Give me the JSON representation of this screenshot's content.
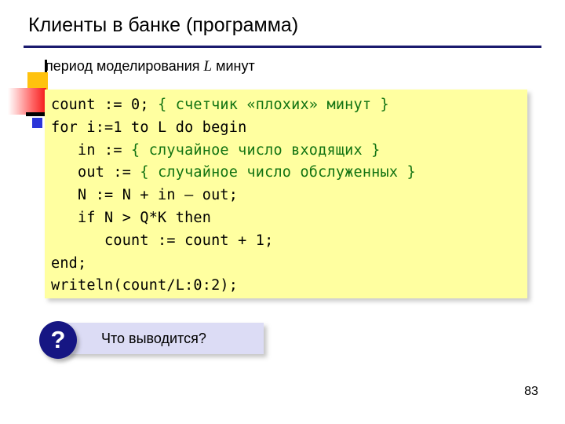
{
  "slide": {
    "title": "Клиенты в банке (программа)",
    "page_number": "83",
    "accent_rule_color": "#1a1a6e"
  },
  "subtitle": {
    "prefix": "период моделирования ",
    "variable": "L",
    "suffix": " минут"
  },
  "decorations": {
    "yellow_square_color": "#ffc20e",
    "red_block_color": "#f41818",
    "black_bar_color": "#000000",
    "blue_square_color": "#2b35d8"
  },
  "code_block": {
    "background_color": "#ffffa0",
    "code_color": "#000000",
    "comment_color": "#127312",
    "lines": [
      {
        "code": "count := 0; ",
        "comment": "{ счетчик «плохих» минут }"
      },
      {
        "code": "for i:=1 to L do begin",
        "comment": ""
      },
      {
        "code": "   in := ",
        "comment": "{ случайное число входящих }"
      },
      {
        "code": "   out := ",
        "comment": "{ случайное число обслуженных }"
      },
      {
        "code": "   N := N + in – out;",
        "comment": ""
      },
      {
        "code": "   if N > Q*K then",
        "comment": ""
      },
      {
        "code": "      count := count + 1;",
        "comment": ""
      },
      {
        "code": "end;",
        "comment": ""
      },
      {
        "code": "writeln(count/L:0:2);",
        "comment": ""
      }
    ]
  },
  "callout": {
    "badge_glyph": "?",
    "label": "Что выводится?",
    "plate_color": "#dcdcf5",
    "badge_color": "#161683"
  }
}
